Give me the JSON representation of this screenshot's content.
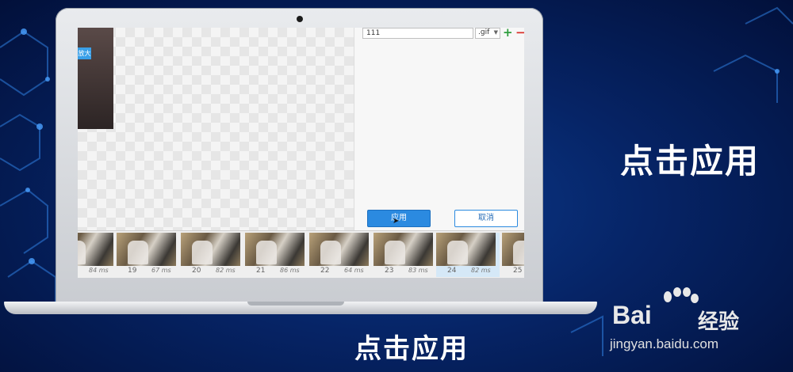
{
  "editor": {
    "filename_value": "111",
    "extension_selected": ".gif",
    "badge_text": "放大",
    "apply_label": "应用",
    "cancel_label": "取消"
  },
  "frames": [
    {
      "number": "",
      "duration": "84 ms"
    },
    {
      "number": "19",
      "duration": "67 ms"
    },
    {
      "number": "20",
      "duration": "82 ms"
    },
    {
      "number": "21",
      "duration": "86 ms"
    },
    {
      "number": "22",
      "duration": "64 ms"
    },
    {
      "number": "23",
      "duration": "83 ms"
    },
    {
      "number": "24",
      "duration": "82 ms"
    },
    {
      "number": "25",
      "duration": ""
    }
  ],
  "selected_frame_number": "24",
  "captions": {
    "side": "点击应用",
    "bottom": "点击应用"
  },
  "watermark": {
    "brand": "Bai",
    "brand_cn": "经验",
    "url": "jingyan.baidu.com"
  },
  "colors": {
    "accent": "#2b8ae0",
    "background": "#062466"
  }
}
